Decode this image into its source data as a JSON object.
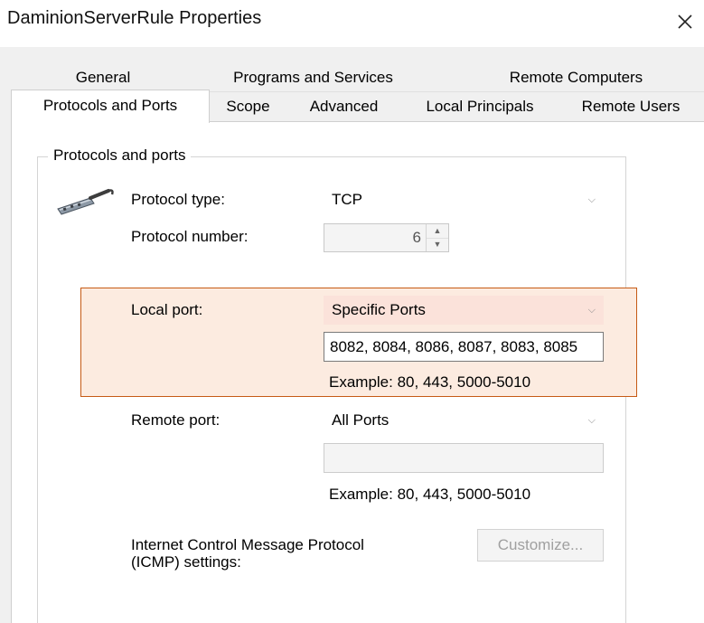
{
  "window": {
    "title": "DaminionServerRule Properties",
    "close_glyph": "✕"
  },
  "tabs": {
    "row1": [
      "General",
      "Programs and Services",
      "Remote Computers"
    ],
    "row2": [
      "Protocols and Ports",
      "Scope",
      "Advanced",
      "Local Principals",
      "Remote Users"
    ],
    "selected": "Protocols and Ports"
  },
  "group": {
    "title": "Protocols and ports",
    "icon": "network-cable-icon"
  },
  "protocol_type": {
    "label": "Protocol type:",
    "value": "TCP"
  },
  "protocol_number": {
    "label": "Protocol number:",
    "value": "6"
  },
  "local_port": {
    "label": "Local port:",
    "value": "Specific Ports",
    "ports": "8082, 8084, 8086, 8087, 8083, 8085",
    "example": "Example: 80, 443, 5000-5010",
    "highlight_color": "#c65a15"
  },
  "remote_port": {
    "label": "Remote port:",
    "value": "All Ports",
    "ports": "",
    "example": "Example: 80, 443, 5000-5010"
  },
  "icmp": {
    "label_line1": "Internet Control Message Protocol",
    "label_line2": "(ICMP) settings:",
    "button": "Customize..."
  }
}
